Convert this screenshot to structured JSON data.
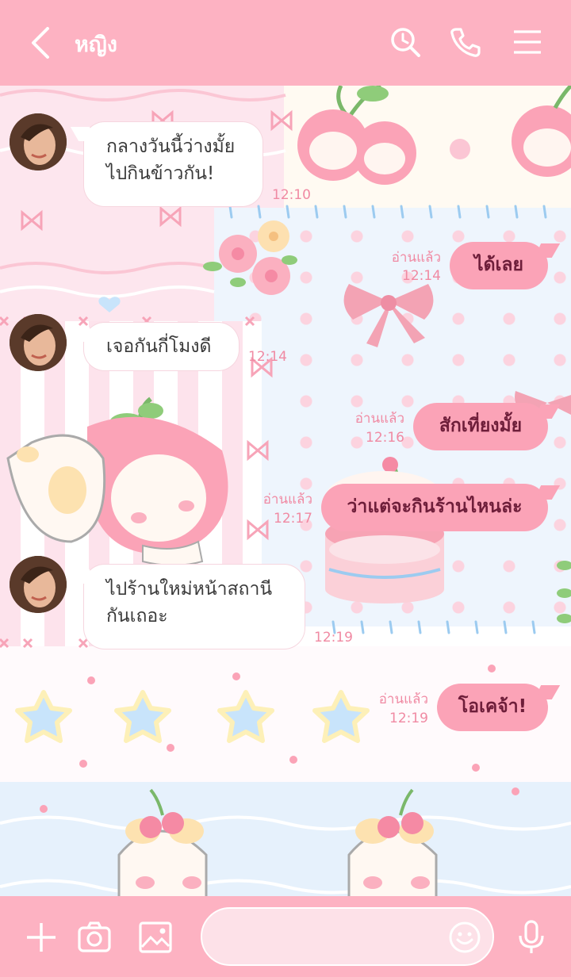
{
  "header": {
    "contact_name": "หญิง"
  },
  "messages": [
    {
      "side": "in",
      "lines": [
        "กลางวันนี้ว่างมั้ย",
        "ไปกินข้าวกัน!"
      ],
      "time": "12:10"
    },
    {
      "side": "out",
      "text": "ได้เลย",
      "read": "อ่านแล้ว",
      "time": "12:14"
    },
    {
      "side": "in",
      "lines": [
        "เจอกันกี่โมงดี"
      ],
      "time": "12:14"
    },
    {
      "side": "out",
      "text": "สักเที่ยงมั้ย",
      "read": "อ่านแล้ว",
      "time": "12:16"
    },
    {
      "side": "out",
      "text": "ว่าแต่จะกินร้านไหนล่ะ",
      "read": "อ่านแล้ว",
      "time": "12:17"
    },
    {
      "side": "in",
      "lines": [
        "ไปร้านใหม่หน้าสถานี",
        "กันเถอะ"
      ],
      "time": "12:19"
    },
    {
      "side": "out",
      "text": "โอเคจ้า!",
      "read": "อ่านแล้ว",
      "time": "12:19"
    }
  ],
  "icons": {
    "back": "chevron-left-icon",
    "search": "search-icon",
    "call": "phone-icon",
    "menu": "menu-icon",
    "add": "plus-icon",
    "camera": "camera-icon",
    "image": "image-icon",
    "emoji": "smiley-icon",
    "mic": "microphone-icon"
  },
  "colors": {
    "header": "#fdb2c2",
    "bubble_out": "#fba3b7",
    "bubble_out_text": "#6e1e3a",
    "meta_text": "#f08aa3"
  }
}
